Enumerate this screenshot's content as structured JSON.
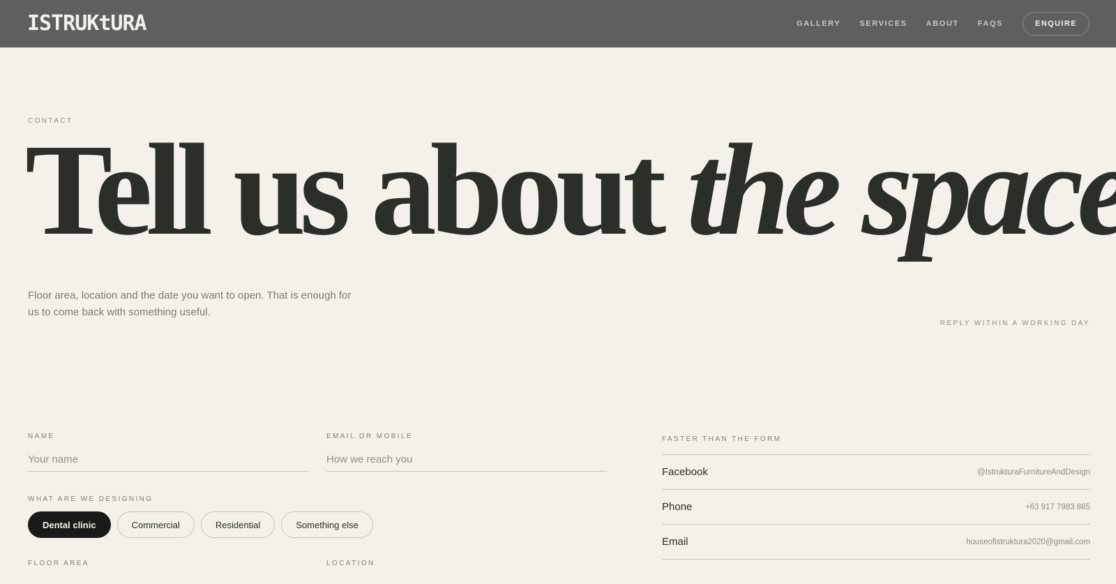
{
  "header": {
    "logo": "ISTRUKtURA",
    "nav": [
      "GALLERY",
      "SERVICES",
      "ABOUT",
      "FAQS"
    ],
    "cta": "ENQUIRE"
  },
  "hero": {
    "eyebrow": "CONTACT",
    "headline_plain": "Tell us about ",
    "headline_italic": "the space",
    "intro": "Floor area, location and the date you want to open. That is enough for us to come back with something useful.",
    "reply_note": "REPLY WITHIN A WORKING DAY"
  },
  "form": {
    "name_label": "NAME",
    "name_placeholder": "Your name",
    "contact_label": "EMAIL OR MOBILE",
    "contact_placeholder": "How we reach you",
    "designing_label": "WHAT ARE WE DESIGNING",
    "options": [
      "Dental clinic",
      "Commercial",
      "Residential",
      "Something else"
    ],
    "selected_option": "Dental clinic",
    "floor_area_label": "FLOOR AREA",
    "location_label": "LOCATION"
  },
  "contact": {
    "heading": "FASTER THAN THE FORM",
    "rows": [
      {
        "name": "Facebook",
        "value": "@IstrukturaFurnitureAndDesign"
      },
      {
        "name": "Phone",
        "value": "+63 917 7983 865"
      },
      {
        "name": "Email",
        "value": "houseofistruktura2020@gmail.com"
      }
    ]
  },
  "colors": {
    "header_bg": "#5e605d",
    "page_bg": "#f3f1ea",
    "ink": "#2b2e29",
    "chip_active": "#1a1b19"
  }
}
